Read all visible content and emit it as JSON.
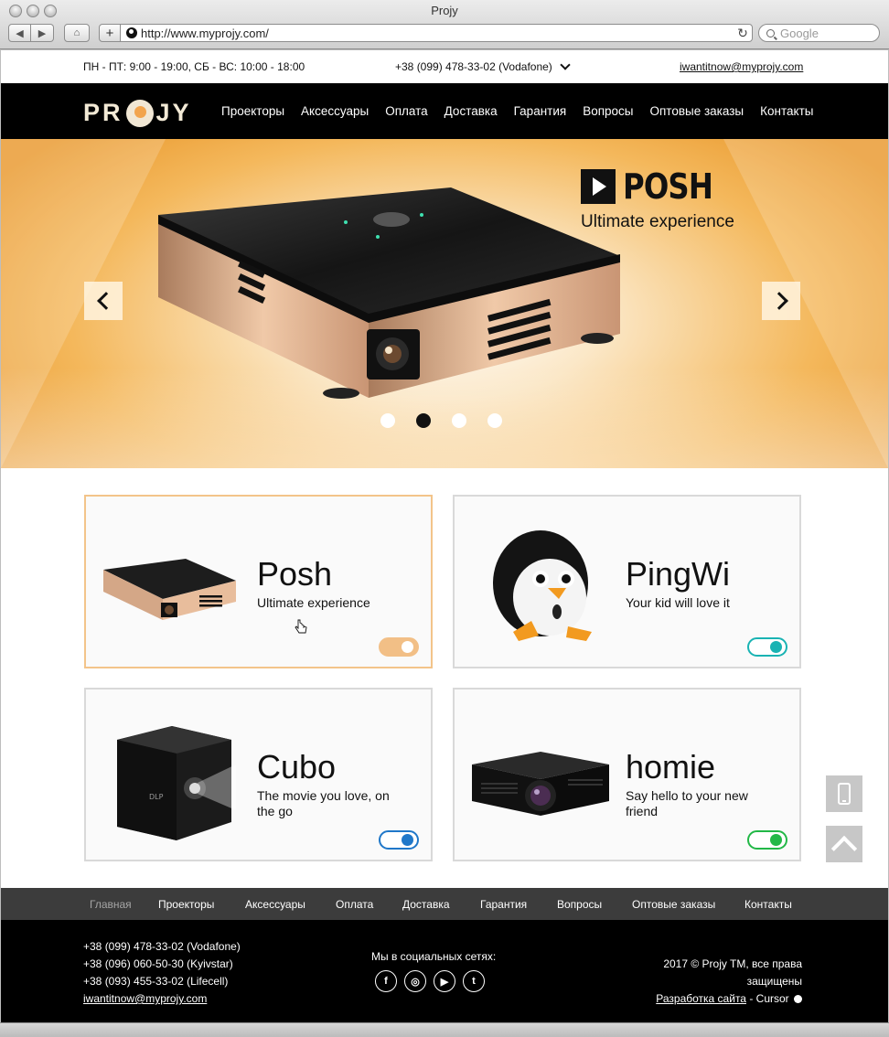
{
  "browser": {
    "title": "Projy",
    "url": "http://www.myprojy.com/",
    "search_placeholder": "Google"
  },
  "topbar": {
    "hours": "ПН - ПТ: 9:00 - 19:00, СБ - ВС: 10:00 - 18:00",
    "phone": "+38 (099) 478-33-02 (Vodafone)",
    "email": "iwantitnow@myprojy.com"
  },
  "nav": {
    "logo_left": "PR",
    "logo_right": "JY",
    "items": [
      "Проекторы",
      "Аксессуары",
      "Оплата",
      "Доставка",
      "Гарантия",
      "Вопросы",
      "Оптовые заказы",
      "Контакты"
    ]
  },
  "hero": {
    "brand": "POSH",
    "subtitle": "Ultimate experience",
    "slide_count": 4,
    "active_slide": 2
  },
  "products": [
    {
      "name": "Posh",
      "desc": "Ultimate experience",
      "toggle_color": "#f2bf86"
    },
    {
      "name": "PingWi",
      "desc": "Your kid will love it",
      "toggle_color": "#19b3b3"
    },
    {
      "name": "Cubo",
      "desc": "The movie you love, on the go",
      "toggle_color": "#1f77c9"
    },
    {
      "name": "homie",
      "desc": "Say hello to your new friend",
      "toggle_color": "#22b847"
    }
  ],
  "footer_nav": {
    "items": [
      "Главная",
      "Проекторы",
      "Аксессуары",
      "Оплата",
      "Доставка",
      "Гарантия",
      "Вопросы",
      "Оптовые заказы",
      "Контакты"
    ],
    "current": "Главная"
  },
  "footer": {
    "phones": [
      "+38 (099) 478-33-02 (Vodafone)",
      "+38 (096) 060-50-30 (Kyivstar)",
      "+38 (093) 455-33-02 (Lifecell)"
    ],
    "email": "iwantitnow@myprojy.com",
    "social_label": "Мы в социальных сетях:",
    "social_icons": [
      "facebook-icon",
      "instagram-icon",
      "youtube-icon",
      "twitter-icon"
    ],
    "copyright": "2017 © Projy TM, все права защищены",
    "dev_link": "Разработка сайта",
    "dev_sep": " - Cursor"
  }
}
